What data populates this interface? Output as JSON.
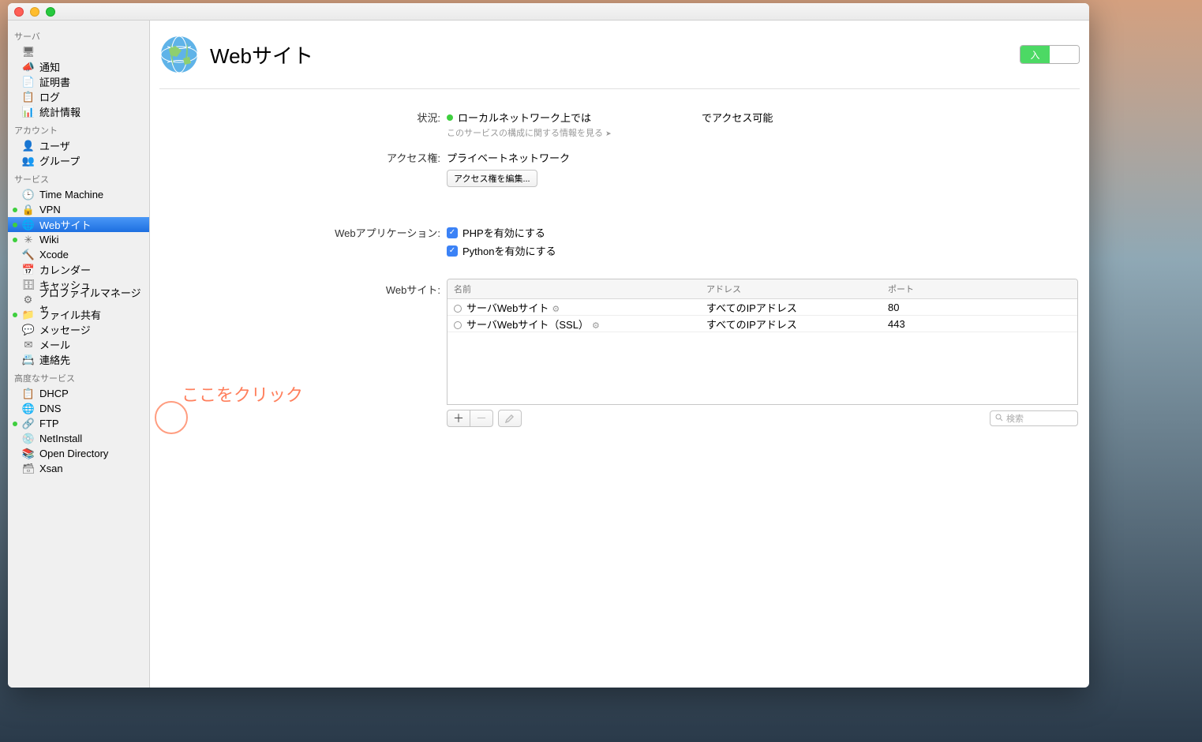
{
  "header": {
    "title": "Webサイト",
    "toggle_on": "入"
  },
  "sidebar": {
    "sections": [
      {
        "header": "サーバ",
        "items": [
          {
            "label": "通知",
            "icon": "megaphone"
          },
          {
            "label": "証明書",
            "icon": "cert"
          },
          {
            "label": "ログ",
            "icon": "log"
          },
          {
            "label": "統計情報",
            "icon": "stats"
          }
        ]
      },
      {
        "header": "アカウント",
        "items": [
          {
            "label": "ユーザ",
            "icon": "user"
          },
          {
            "label": "グループ",
            "icon": "group"
          }
        ]
      },
      {
        "header": "サービス",
        "items": [
          {
            "label": "Time Machine",
            "icon": "tm"
          },
          {
            "label": "VPN",
            "icon": "lock",
            "status": "green"
          },
          {
            "label": "Webサイト",
            "icon": "globe",
            "status": "green",
            "selected": true
          },
          {
            "label": "Wiki",
            "icon": "wiki",
            "status": "green"
          },
          {
            "label": "Xcode",
            "icon": "xcode"
          },
          {
            "label": "カレンダー",
            "icon": "cal"
          },
          {
            "label": "キャッシュ",
            "icon": "cache"
          },
          {
            "label": "プロファイルマネージャ",
            "icon": "profile"
          },
          {
            "label": "ファイル共有",
            "icon": "fileshare",
            "status": "green"
          },
          {
            "label": "メッセージ",
            "icon": "msg"
          },
          {
            "label": "メール",
            "icon": "mail"
          },
          {
            "label": "連絡先",
            "icon": "contacts"
          }
        ]
      },
      {
        "header": "高度なサービス",
        "items": [
          {
            "label": "DHCP",
            "icon": "dhcp"
          },
          {
            "label": "DNS",
            "icon": "dns"
          },
          {
            "label": "FTP",
            "icon": "ftp",
            "status": "green"
          },
          {
            "label": "NetInstall",
            "icon": "netinstall"
          },
          {
            "label": "Open Directory",
            "icon": "od"
          },
          {
            "label": "Xsan",
            "icon": "xsan"
          }
        ]
      }
    ]
  },
  "status": {
    "label": "状況:",
    "text1": "ローカルネットワーク上では",
    "text2": "でアクセス可能",
    "sublink": "このサービスの構成に関する情報を見る"
  },
  "access": {
    "label": "アクセス権:",
    "value": "プライベートネットワーク",
    "button": "アクセス権を編集..."
  },
  "webapp": {
    "label": "Webアプリケーション:",
    "php": "PHPを有効にする",
    "python": "Pythonを有効にする"
  },
  "websites": {
    "label": "Webサイト:",
    "columns": {
      "name": "名前",
      "address": "アドレス",
      "port": "ポート"
    },
    "rows": [
      {
        "name": "サーバWebサイト",
        "address": "すべてのIPアドレス",
        "port": "80"
      },
      {
        "name": "サーバWebサイト（SSL）",
        "address": "すべてのIPアドレス",
        "port": "443"
      }
    ],
    "search_placeholder": "検索"
  },
  "annotation": {
    "text": "ここをクリック"
  }
}
